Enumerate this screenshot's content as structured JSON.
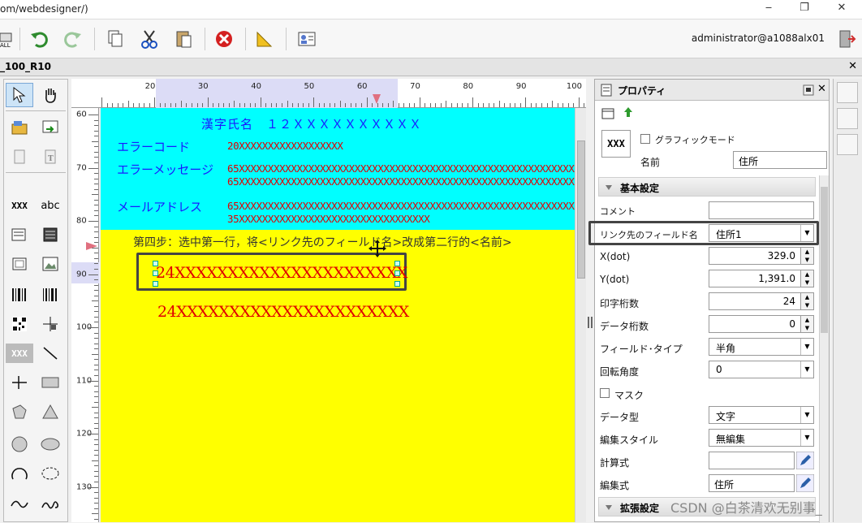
{
  "address_bar": {
    "url": "om/webdesigner/)",
    "minimize": "‒",
    "restore": "❐",
    "close": "✕"
  },
  "toolbar": {
    "user": "administrator@a1088alx01",
    "buttons": [
      "undo-icon",
      "redo-icon",
      "copy-icon",
      "cut-icon",
      "paste-icon",
      "delete-icon",
      "ruler-icon",
      "properties-icon"
    ]
  },
  "document": {
    "title": "_100_R10",
    "close": "✕"
  },
  "ruler": {
    "h_ticks": [
      "20",
      "30",
      "40",
      "50",
      "60",
      "70",
      "80",
      "90",
      "100"
    ],
    "v_ticks": [
      "60",
      "70",
      "80",
      "90",
      "100",
      "110",
      "120",
      "130"
    ]
  },
  "tools": {
    "barcode_label": "XXX",
    "text_label": "abc"
  },
  "canvas": {
    "kanji_name": "漢字氏名　１２ＸＸＸＸＸＸＸＸＸＸ",
    "error_code_label": "エラーコード",
    "error_code_value": "20XXXXXXXXXXXXXXXXXX",
    "error_msg_label": "エラーメッセージ",
    "error_msg_line1": "65XXXXXXXXXXXXXXXXXXXXXXXXXXXXXXXXXXXXXXXXXXXXXXXXXXXXXXXXXXXXXXX",
    "error_msg_line2": "65XXXXXXXXXXXXXXXXXXXXXXXXXXXXXXXXXXXXXXXXXXXXXXXXXXXXXXXXXXXXXXX",
    "mail_label": "メールアドレス",
    "mail_line1": "65XXXXXXXXXXXXXXXXXXXXXXXXXXXXXXXXXXXXXXXXXXXXXXXXXXXXXXXXXXXXXXX",
    "mail_line2": "35XXXXXXXXXXXXXXXXXXXXXXXXXXXXXXXXX",
    "instruction": "第四步：选中第一行，将<リンク先のフィールド名>改成第二行的<名前>",
    "field_selected": "24XXXXXXXXXXXXXXXXXXXXXX",
    "field_second": "24XXXXXXXXXXXXXXXXXXXXXX"
  },
  "properties": {
    "title": "プロパティ",
    "graphic_mode": "グラフィックモード",
    "type_icon": "XXX",
    "name_label": "名前",
    "name_value": "住所",
    "basic_section": "基本設定",
    "comment_label": "コメント",
    "comment_value": "",
    "link_field_label": "リンク先のフィールド名",
    "link_field_value": "住所1",
    "x_label": "X(dot)",
    "x_value": "329.0",
    "y_label": "Y(dot)",
    "y_value": "1,391.0",
    "print_digits_label": "印字桁数",
    "print_digits_value": "24",
    "data_digits_label": "データ桁数",
    "data_digits_value": "0",
    "field_type_label": "フィールド･タイプ",
    "field_type_value": "半角",
    "rotation_label": "回転角度",
    "rotation_value": "0",
    "mask_label": "マスク",
    "data_type_label": "データ型",
    "data_type_value": "文字",
    "edit_style_label": "編集スタイル",
    "edit_style_value": "無編集",
    "formula_label": "計算式",
    "formula_value": "",
    "edit_expr_label": "編集式",
    "edit_expr_value": "住所",
    "ext_section": "拡張設定"
  },
  "watermark": "CSDN @白茶清欢无别事_"
}
